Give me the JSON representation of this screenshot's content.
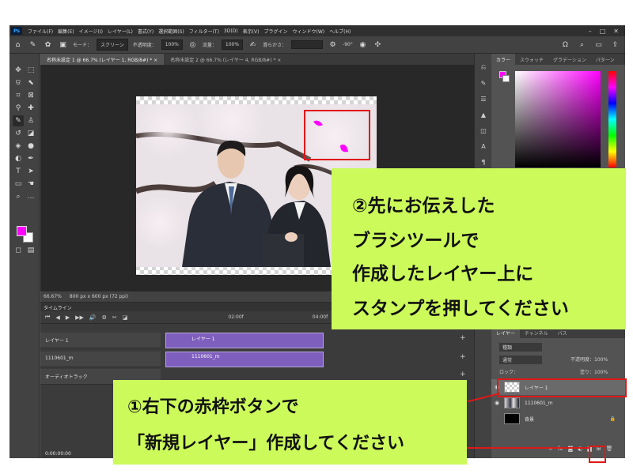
{
  "menubar": {
    "logo": "Ps",
    "items": [
      "ファイル(F)",
      "編集(E)",
      "イメージ(I)",
      "レイヤー(L)",
      "書式(Y)",
      "選択範囲(S)",
      "フィルター(T)",
      "3D(D)",
      "表示(V)",
      "プラグイン",
      "ウィンドウ(W)",
      "ヘルプ(H)"
    ]
  },
  "options": {
    "mode_label": "モード：",
    "mode_value": "スクリーン",
    "opacity_label": "不透明度：",
    "opacity_value": "100%",
    "flow_label": "流量：",
    "flow_value": "100%",
    "smoothing_label": "滑らかさ：",
    "angle_value": "-90°"
  },
  "tabs": [
    "名称未設定 1 @ 66.7% (レイヤー 1, RGB/8#) * ×",
    "名称未設定 2 @ 66.7% (レイヤー 4, RGB/8#) * ×"
  ],
  "statusbar": {
    "zoom": "66.67%",
    "doc_info": "800 px x 600 px (72 ppi)"
  },
  "timeline": {
    "title": "タイムライン",
    "time_marks": [
      "02:00f",
      "04:00f"
    ],
    "tracks": [
      {
        "name": "レイヤー 1",
        "clip": "レイヤー 1"
      },
      {
        "name": "1110601_m",
        "clip": "1110601_m"
      }
    ],
    "audio_track": "オーディオトラック",
    "timecode": "0:00:00:00"
  },
  "right_panel": {
    "tabs": [
      "カラー",
      "スウォッチ",
      "グラデーション",
      "パターン"
    ],
    "colors": {
      "fg": "#ff00ff",
      "bg": "#ffffff"
    }
  },
  "layers_panel": {
    "tabs": [
      "レイヤー",
      "チャンネル",
      "パス"
    ],
    "kind_label": "種類",
    "blend_mode": "通常",
    "opacity_label": "不透明度：",
    "opacity_value": "100%",
    "lock_label": "ロック：",
    "fill_label": "塗り：",
    "fill_value": "100%",
    "layers": [
      {
        "name": "レイヤー 1",
        "selected": true
      },
      {
        "name": "1110601_m",
        "selected": false
      },
      {
        "name": "背景",
        "selected": false
      }
    ]
  },
  "callouts": {
    "top": {
      "line1": "②先にお伝えした",
      "line2": "ブラシツールで",
      "line3": "作成したレイヤー上に",
      "line4": "スタンプを押してください"
    },
    "bottom": {
      "line1": "①右下の赤枠ボタンで",
      "line2": "「新規レイヤー」作成してください"
    },
    "bg_color": "#ccfa5a",
    "frame_color": "#e01818"
  }
}
